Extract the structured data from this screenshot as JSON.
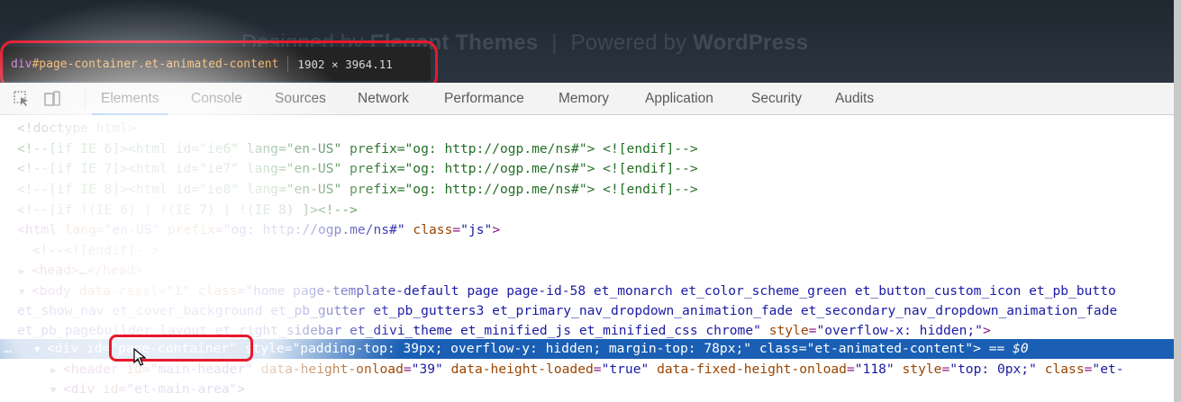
{
  "page": {
    "footer_designed": "Designed by",
    "footer_brand": "Elegant Themes",
    "footer_sep": "|",
    "footer_powered": "Powered by",
    "footer_platform": "WordPress"
  },
  "tooltip": {
    "tag": "div",
    "selector": "#page-container.et-animated-content",
    "dimensions": "1902 × 3964.11"
  },
  "toolbar": {
    "inspect_icon": "inspect-element-icon",
    "device_icon": "device-toolbar-icon",
    "tabs": [
      {
        "label": "Elements",
        "active": true
      },
      {
        "label": "Console"
      },
      {
        "label": "Sources"
      },
      {
        "label": "Network"
      },
      {
        "label": "Performance"
      },
      {
        "label": "Memory"
      },
      {
        "label": "Application"
      },
      {
        "label": "Security"
      },
      {
        "label": "Audits"
      }
    ]
  },
  "tree": {
    "l0": "<!doctype html>",
    "l1": "<!--[if IE 6]><html id=\"ie6\" lang=\"en-US\" prefix=\"og: http://ogp.me/ns#\"> <![endif]-->",
    "l2": "<!--[if IE 7]><html id=\"ie7\" lang=\"en-US\" prefix=\"og: http://ogp.me/ns#\"> <![endif]-->",
    "l3": "<!--[if IE 8]><html id=\"ie8\" lang=\"en-US\" prefix=\"og: http://ogp.me/ns#\"> <![endif]-->",
    "l4": "<!--[if !(IE 6) | !(IE 7) | !(IE 8)  ]><!-->",
    "l5": {
      "tag": "html",
      "attr1": "lang",
      "val1": "\"en-US\"",
      "attr2": "prefix",
      "val2": "\"og: http://ogp.me/ns#\"",
      "attr3": "class",
      "val3": "\"js\""
    },
    "l6": "<!--<![endif]-->",
    "l7": {
      "open": "<head>",
      "ellipsis": "…",
      "close": "</head>"
    },
    "l8": {
      "tag": "body",
      "attr1": "data-rsssl",
      "val1": "\"1\"",
      "attr2": "class",
      "val2": "\"home page-template-default page page-id-58 et_monarch et_color_scheme_green et_button_custom_icon et_pb_butto"
    },
    "l9": "et_show_nav et_cover_background et_pb_gutter et_pb_gutters3 et_primary_nav_dropdown_animation_fade et_secondary_nav_dropdown_animation_fade",
    "l10": {
      "text": "et_pb_pagebuilder_layout et_right_sidebar et_divi_theme et_minified_js et_minified_css chrome\"",
      "attr": "style",
      "val": "\"overflow-x: hidden;\""
    },
    "l11": {
      "dots": "…",
      "tag": "div",
      "attr1": "id",
      "val1": "\"page-container\"",
      "attr2": "style",
      "val2": "\"padding-top: 39px; overflow-y: hidden; margin-top: 78px;\"",
      "attr3": "class",
      "val3": "\"et-animated-content\"",
      "eq": "== $0"
    },
    "l12": {
      "tag": "header",
      "attr1": "id",
      "val1": "\"main-header\"",
      "attr2": "data-height-onload",
      "val2": "\"39\"",
      "attr3": "data-height-loaded",
      "val3": "\"true\"",
      "attr4": "data-fixed-height-onload",
      "val4": "\"118\"",
      "attr5": "style",
      "val5": "\"top: 0px;\"",
      "attr6": "class",
      "val6": "\"et-"
    },
    "l13": {
      "tag": "div",
      "attr1": "id",
      "val1": "\"et-main-area\""
    }
  }
}
